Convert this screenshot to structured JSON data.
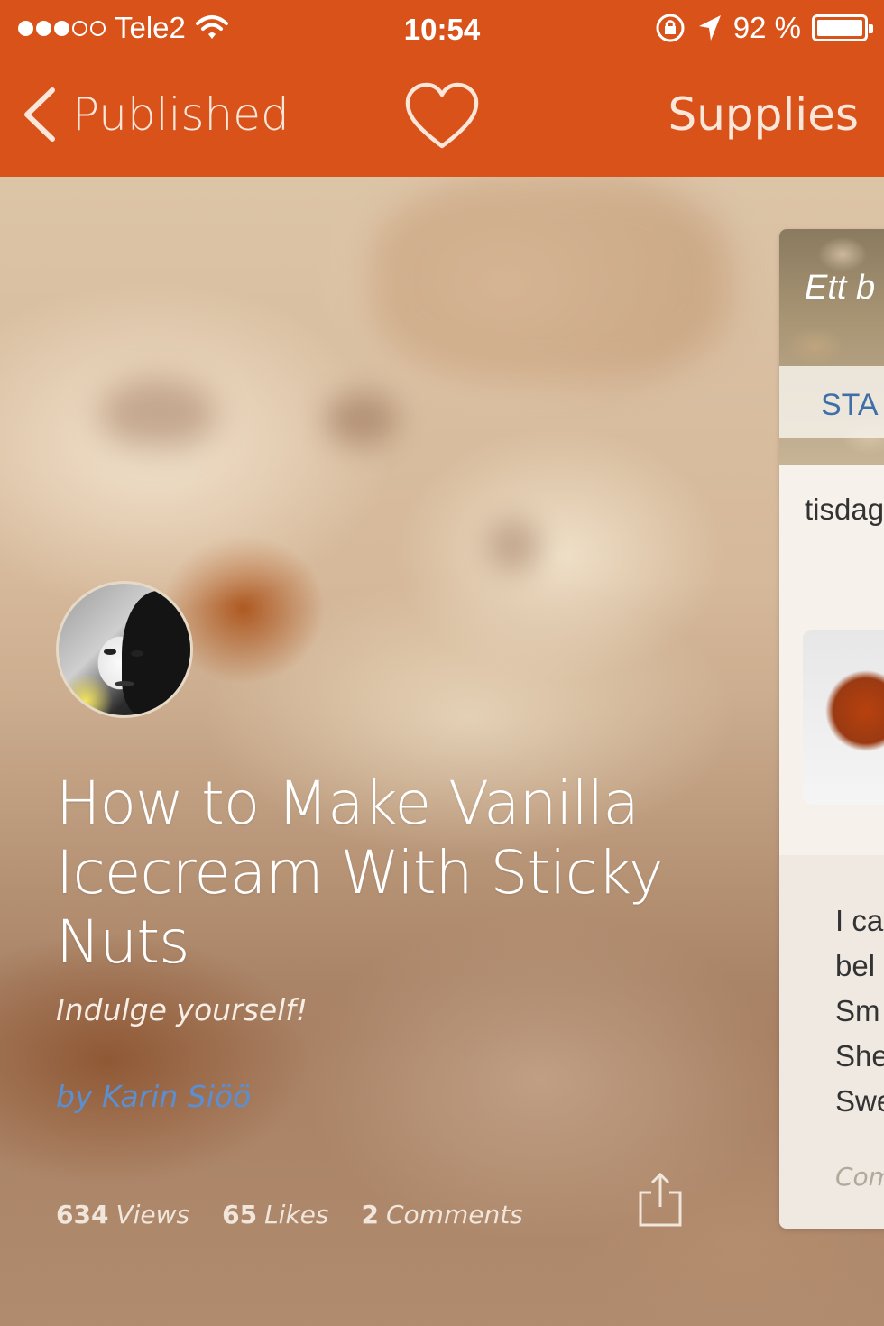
{
  "status_bar": {
    "carrier": "Tele2",
    "time": "10:54",
    "battery": "92 %"
  },
  "nav": {
    "back_label": "Published",
    "right_label": "Supplies"
  },
  "guide": {
    "title": "How to Make Vanilla Icecream With Sticky Nuts",
    "subtitle": "Indulge yourself!",
    "author": "by Karin Siöö",
    "stats": {
      "views_count": "634",
      "views_label": "Views",
      "likes_count": "65",
      "likes_label": "Likes",
      "comments_count": "2",
      "comments_label": "Comments"
    }
  },
  "peek_card": {
    "photo_title": "Ett b",
    "band_text": "STA",
    "day": "tisdag",
    "lines": [
      "I ca",
      "bel",
      "Sm",
      "She",
      "Swe"
    ],
    "comments": "Com"
  },
  "colors": {
    "brand": "#d9521a",
    "author_link": "#5b8fd1"
  }
}
